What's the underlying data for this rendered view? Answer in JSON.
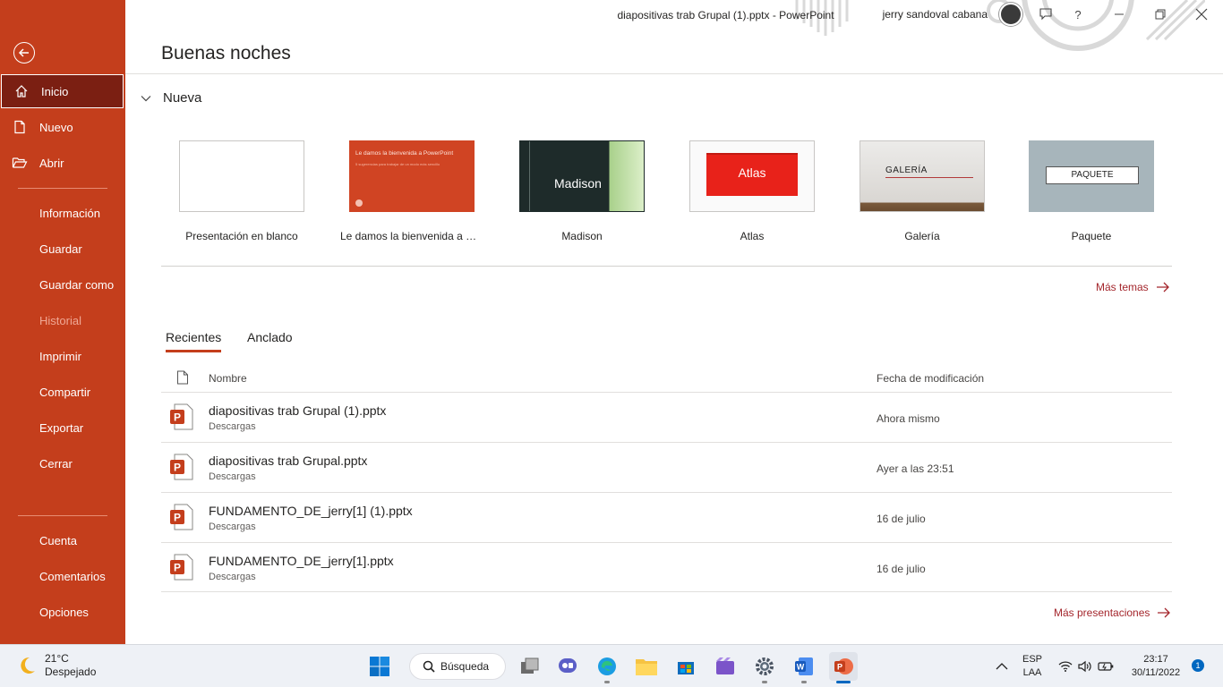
{
  "window": {
    "title": "diapositivas trab Grupal (1).pptx  -  PowerPoint",
    "user_name": "jerry sandoval cabana",
    "help": "?"
  },
  "sidebar": {
    "items": [
      {
        "label": "Inicio",
        "icon": "home-icon"
      },
      {
        "label": "Nuevo",
        "icon": "new-document-icon"
      },
      {
        "label": "Abrir",
        "icon": "folder-open-icon"
      },
      {
        "label": "Información"
      },
      {
        "label": "Guardar"
      },
      {
        "label": "Guardar como"
      },
      {
        "label": "Historial"
      },
      {
        "label": "Imprimir"
      },
      {
        "label": "Compartir"
      },
      {
        "label": "Exportar"
      },
      {
        "label": "Cerrar"
      },
      {
        "label": "Cuenta"
      },
      {
        "label": "Comentarios"
      },
      {
        "label": "Opciones"
      }
    ]
  },
  "greeting": "Buenas noches",
  "new_section": {
    "label": "Nueva",
    "templates": [
      {
        "name": "Presentación en blanco"
      },
      {
        "name": "Le damos la bienvenida a Po...",
        "thumb_title": "Le damos la bienvenida a PowerPoint",
        "thumb_sub": "5 sugerencias para trabajar de un modo más sencillo"
      },
      {
        "name": "Madison",
        "thumb_title": "Madison"
      },
      {
        "name": "Atlas",
        "thumb_title": "Atlas"
      },
      {
        "name": "Galería",
        "thumb_title": "GALERÍA"
      },
      {
        "name": "Paquete",
        "thumb_title": "PAQUETE"
      }
    ],
    "more_themes": "Más temas"
  },
  "recent": {
    "tabs": [
      "Recientes",
      "Anclado"
    ],
    "col_name": "Nombre",
    "col_date": "Fecha de modificación",
    "files": [
      {
        "name": "diapositivas trab Grupal (1).pptx",
        "location": "Descargas",
        "date": "Ahora mismo"
      },
      {
        "name": "diapositivas trab Grupal.pptx",
        "location": "Descargas",
        "date": "Ayer a las 23:51"
      },
      {
        "name": "FUNDAMENTO_DE_jerry[1] (1).pptx",
        "location": "Descargas",
        "date": "16 de julio"
      },
      {
        "name": "FUNDAMENTO_DE_jerry[1].pptx",
        "location": "Descargas",
        "date": "16 de julio"
      }
    ],
    "more_presentations": "Más presentaciones"
  },
  "taskbar": {
    "weather_temp": "21°C",
    "weather_desc": "Despejado",
    "search_label": "Búsqueda",
    "lang_top": "ESP",
    "lang_bottom": "LAA",
    "time": "23:17",
    "date": "30/11/2022",
    "notif_count": "1"
  },
  "colors": {
    "accent": "#c43e1c",
    "accent_dark": "#7b1f12",
    "link": "#a4262c"
  }
}
